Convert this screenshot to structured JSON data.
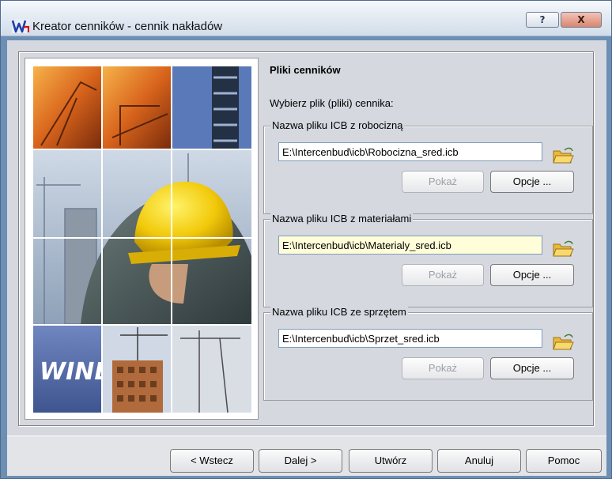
{
  "window": {
    "title": "Kreator cenników - cennik nakładów"
  },
  "titlebar": {
    "help_label": "?",
    "close_label": "X"
  },
  "image": {
    "logo_text": "WINBUD"
  },
  "page": {
    "section_title": "Pliki cenników",
    "choose_label": "Wybierz plik (pliki) cennika:"
  },
  "groups": [
    {
      "label": "Nazwa pliku ICB z robocizną",
      "path": "E:\\Intercenbud\\icb\\Robocizna_sred.icb",
      "show_label": "Pokaż",
      "options_label": "Opcje ..."
    },
    {
      "label": "Nazwa pliku ICB z materiałami",
      "path": "E:\\Intercenbud\\icb\\Materialy_sred.icb",
      "show_label": "Pokaż",
      "options_label": "Opcje ..."
    },
    {
      "label": "Nazwa pliku ICB ze sprzętem",
      "path": "E:\\Intercenbud\\icb\\Sprzet_sred.icb",
      "show_label": "Pokaż",
      "options_label": "Opcje ..."
    }
  ],
  "footer": {
    "back_label": "< Wstecz",
    "next_label": "Dalej >",
    "create_label": "Utwórz",
    "cancel_label": "Anuluj",
    "help_label": "Pomoc"
  },
  "colors": {
    "highlight_field": "#fffed9",
    "title_gradient": "#e4ebf3",
    "dialog_bg": "#d6d8e0"
  }
}
